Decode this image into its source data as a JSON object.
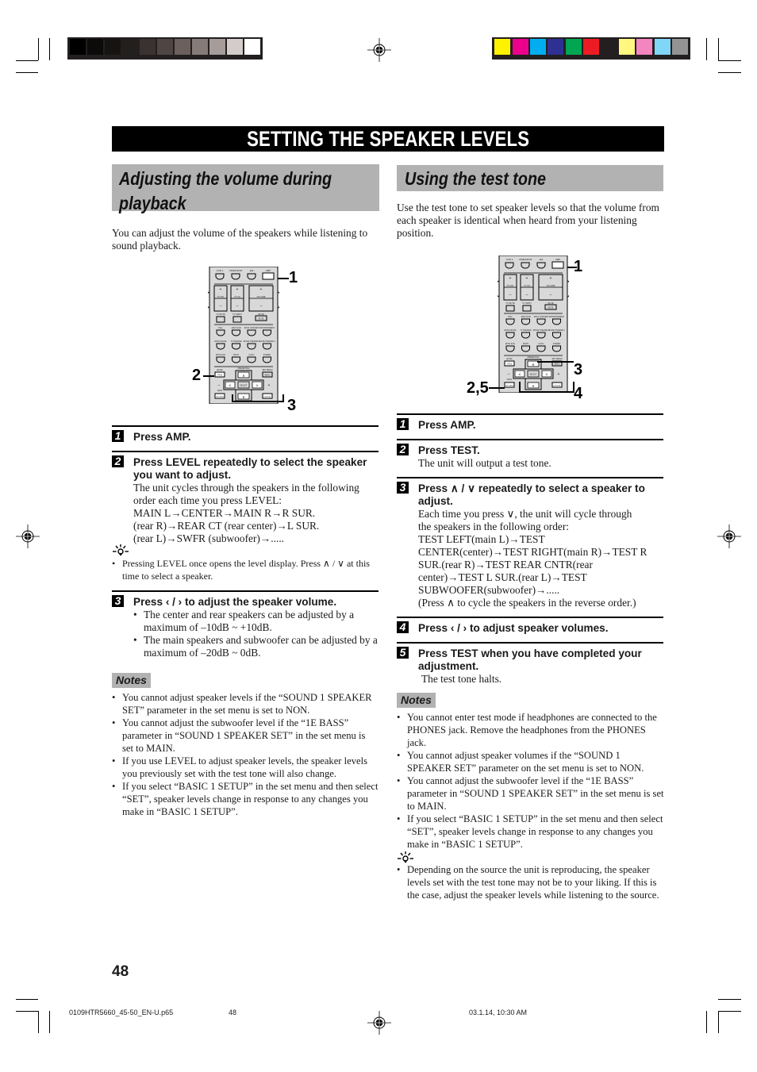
{
  "print_marks": {
    "grayscale_swatches": [
      "#000000",
      "#0d0b0a",
      "#161311",
      "#231f1d",
      "#3a3230",
      "#4f4643",
      "#6b605d",
      "#857b78",
      "#a69d9b",
      "#d3cccb",
      "#ffffff"
    ],
    "color_swatches": [
      "#fff200",
      "#ec008c",
      "#00aeef",
      "#2e3192",
      "#00a651",
      "#ed1c24",
      "#231f20",
      "#fff77f",
      "#f385c1",
      "#7fd6f7",
      "#939393"
    ]
  },
  "page": {
    "title": "SETTING THE SPEAKER LEVELS",
    "page_number": "48"
  },
  "left": {
    "heading_line1": "Adjusting the volume during",
    "heading_line2": "playback",
    "intro": "You can adjust the volume of the speakers while listening to sound playback.",
    "callouts": [
      "1",
      "2",
      "3"
    ],
    "steps": [
      {
        "num": "1",
        "head": "Press AMP."
      },
      {
        "num": "2",
        "head": "Press LEVEL repeatedly to select the speaker you want to adjust.",
        "desc_lines": [
          "The unit cycles through the speakers in the following",
          "order each time you press LEVEL:",
          "MAIN L→CENTER→MAIN R→R SUR.",
          "(rear R)→REAR CT (rear center)→L SUR.",
          "(rear L)→SWFR (subwoofer)→....."
        ]
      },
      {
        "num": "3",
        "head": "Press ‹ / › to adjust the speaker volume.",
        "bullets": [
          "The center and rear speakers can be adjusted by a maximum of –10dB ~ +10dB.",
          "The main speakers and subwoofer can be adjusted by a maximum of –20dB ~ 0dB."
        ]
      }
    ],
    "tip": "Pressing LEVEL once opens the level display. Press ∧ / ∨ at this time to select a speaker.",
    "notes_label": "Notes",
    "notes": [
      "You cannot adjust speaker levels if the “SOUND 1 SPEAKER SET” parameter in the set menu is set to NON.",
      "You cannot adjust the subwoofer level if the “1E BASS” parameter in “SOUND 1 SPEAKER SET” in the set menu is set to MAIN.",
      "If you use LEVEL to adjust speaker levels, the speaker levels you previously set with the test tone will also change.",
      "If you select “BASIC 1 SETUP” in the set menu and then select “SET”, speaker levels change in response to any changes you make in “BASIC 1 SETUP”."
    ]
  },
  "right": {
    "heading": "Using the test tone",
    "intro": "Use the test tone to set speaker levels so that the volume from each speaker is identical when heard from your listening position.",
    "callouts": [
      "1",
      "3",
      "2,5",
      "4"
    ],
    "steps": [
      {
        "num": "1",
        "head": "Press AMP."
      },
      {
        "num": "2",
        "head": "Press TEST.",
        "desc": "The unit will output a test tone."
      },
      {
        "num": "3",
        "head": "Press ∧ / ∨ repeatedly to select a speaker to adjust.",
        "desc_lines": [
          "Each time you press ∨, the unit will cycle through",
          "the speakers in the following order:",
          "TEST LEFT(main L)→TEST",
          "CENTER(center)→TEST RIGHT(main R)→TEST R",
          "SUR.(rear R)→TEST REAR CNTR(rear",
          "center)→TEST L SUR.(rear L)→TEST",
          "SUBWOOFER(subwoofer)→.....",
          "(Press ∧ to cycle the speakers in the reverse order.)"
        ]
      },
      {
        "num": "4",
        "head": "Press ‹ / › to adjust speaker volumes."
      },
      {
        "num": "5",
        "head": "Press TEST when you have completed your adjustment.",
        "desc": "The test tone halts."
      }
    ],
    "notes_label": "Notes",
    "notes": [
      "You cannot enter test mode if headphones are connected to the PHONES jack. Remove the headphones from the PHONES jack.",
      "You cannot adjust speaker volumes if the “SOUND 1 SPEAKER SET” parameter on the set menu is set to NON.",
      "You cannot adjust the subwoofer level if the “1E BASS” parameter in “SOUND 1 SPEAKER SET” in the set menu is set to MAIN.",
      "If you select “BASIC 1 SETUP” in the set menu and then select “SET”, speaker levels change in response to any changes you make in “BASIC 1 SETUP”."
    ],
    "tip": "Depending on the source the unit is reproducing, the speaker levels set with the test tone may not be to your liking. If this is the case, adjust the speaker levels while listening to the source."
  },
  "remote": {
    "top_labels": [
      "VCR 1",
      "VIDEO/DVR",
      "◄►",
      "AMP"
    ],
    "rocker_labels": [
      "TV VOL",
      "TV CH",
      "VOLUME"
    ],
    "mute_labels": [
      "TV MUTE",
      "TV INPUT",
      "MUTE"
    ],
    "dsp_labels": [
      "HALL",
      "JAZZ CLUB",
      "ROCK CONCERT",
      "ENTERTAINMENT",
      "MONO MOVIE",
      "TV THEATER",
      "MOVIE THEATER 1",
      "MOVIE THEATER 2",
      "EXTD SUR.",
      "NIGHT",
      "6.1/5.1",
      "STEREO"
    ],
    "nav_labels": {
      "level": "LEVEL",
      "title": "TITLE",
      "preset": "PRESET/CH",
      "set_menu": "SET MENU",
      "menu": "MENU",
      "select": "SELECT",
      "test": "TEST",
      "return": "RETURN",
      "display": "DISPLAY",
      "minus": "–",
      "plus": "+"
    }
  },
  "footer": {
    "file": "0109HTR5660_45-50_EN-U.p65",
    "page": "48",
    "timestamp": "03.1.14, 10:30 AM"
  }
}
